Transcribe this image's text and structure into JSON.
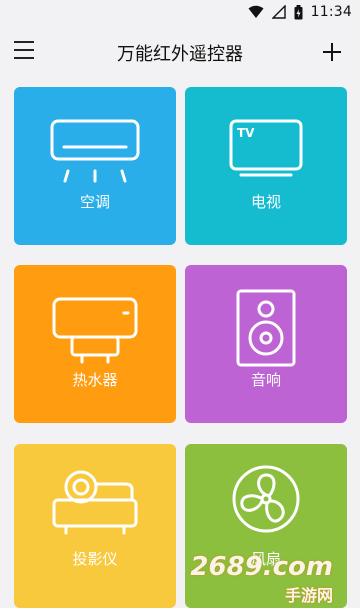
{
  "status": {
    "time": "11:34"
  },
  "appbar": {
    "title": "万能红外遥控器"
  },
  "tiles": [
    {
      "label": "空调",
      "icon": "air-conditioner-icon",
      "color": "#29aee9"
    },
    {
      "label": "电视",
      "icon": "tv-icon",
      "color": "#15bcd0"
    },
    {
      "label": "热水器",
      "icon": "water-heater-icon",
      "color": "#ff9c0f"
    },
    {
      "label": "音响",
      "icon": "speaker-icon",
      "color": "#be63d4"
    },
    {
      "label": "投影仪",
      "icon": "projector-icon",
      "color": "#f9c93d"
    },
    {
      "label": "风扇",
      "icon": "fan-icon",
      "color": "#8cbf3e"
    }
  ],
  "tv_icon_text": "TV",
  "watermark": {
    "main": "2689.com",
    "sub": "手游网"
  }
}
